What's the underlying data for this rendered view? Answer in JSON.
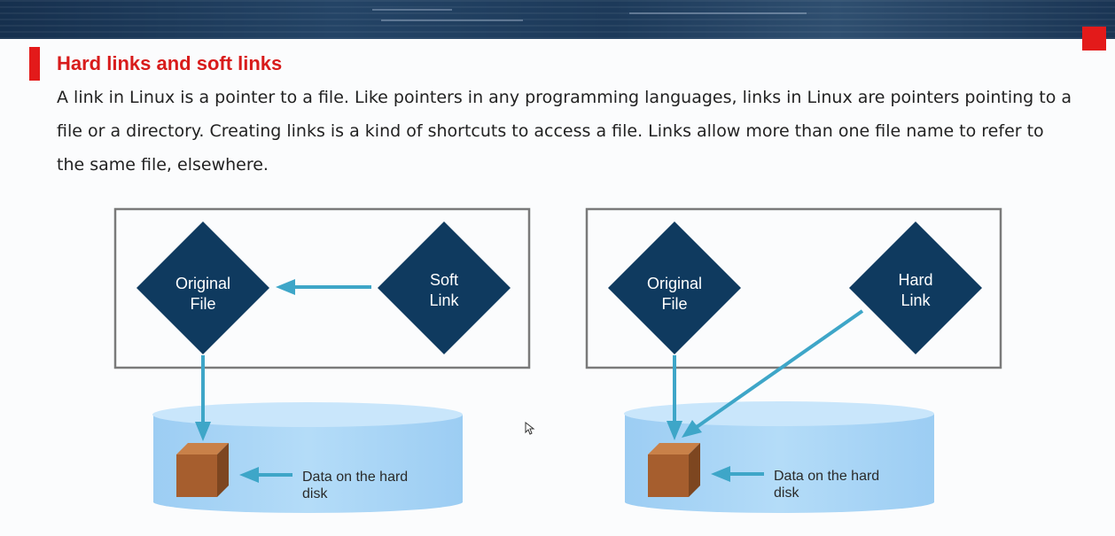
{
  "slide": {
    "title": "Hard links and soft links",
    "paragraph": "A link in Linux is a pointer to a file. Like pointers in any programming languages, links in Linux are pointers pointing to a file or a directory. Creating links is a kind of shortcuts to access a file. Links allow more than one file name to refer to the same file, elsewhere."
  },
  "soft_diagram": {
    "original_line1": "Original",
    "original_line2": "File",
    "link_line1": "Soft",
    "link_line2": "Link",
    "data_line1": "Data on the hard",
    "data_line2": "disk"
  },
  "hard_diagram": {
    "original_line1": "Original",
    "original_line2": "File",
    "link_line1": "Hard",
    "link_line2": "Link",
    "data_line1": "Data on the hard",
    "data_line2": "disk"
  },
  "colors": {
    "accent_red": "#e31a1a",
    "title_red": "#d81b1b",
    "diamond_navy": "#0f3a5f",
    "arrow_teal": "#3ea6c8",
    "disk_light": "#a6d4f6",
    "disk_top": "#c4e3fa",
    "box_brown": "#a65e2e"
  },
  "icons": [
    "cube-icon",
    "arrow-icon",
    "mouse-cursor-icon"
  ]
}
